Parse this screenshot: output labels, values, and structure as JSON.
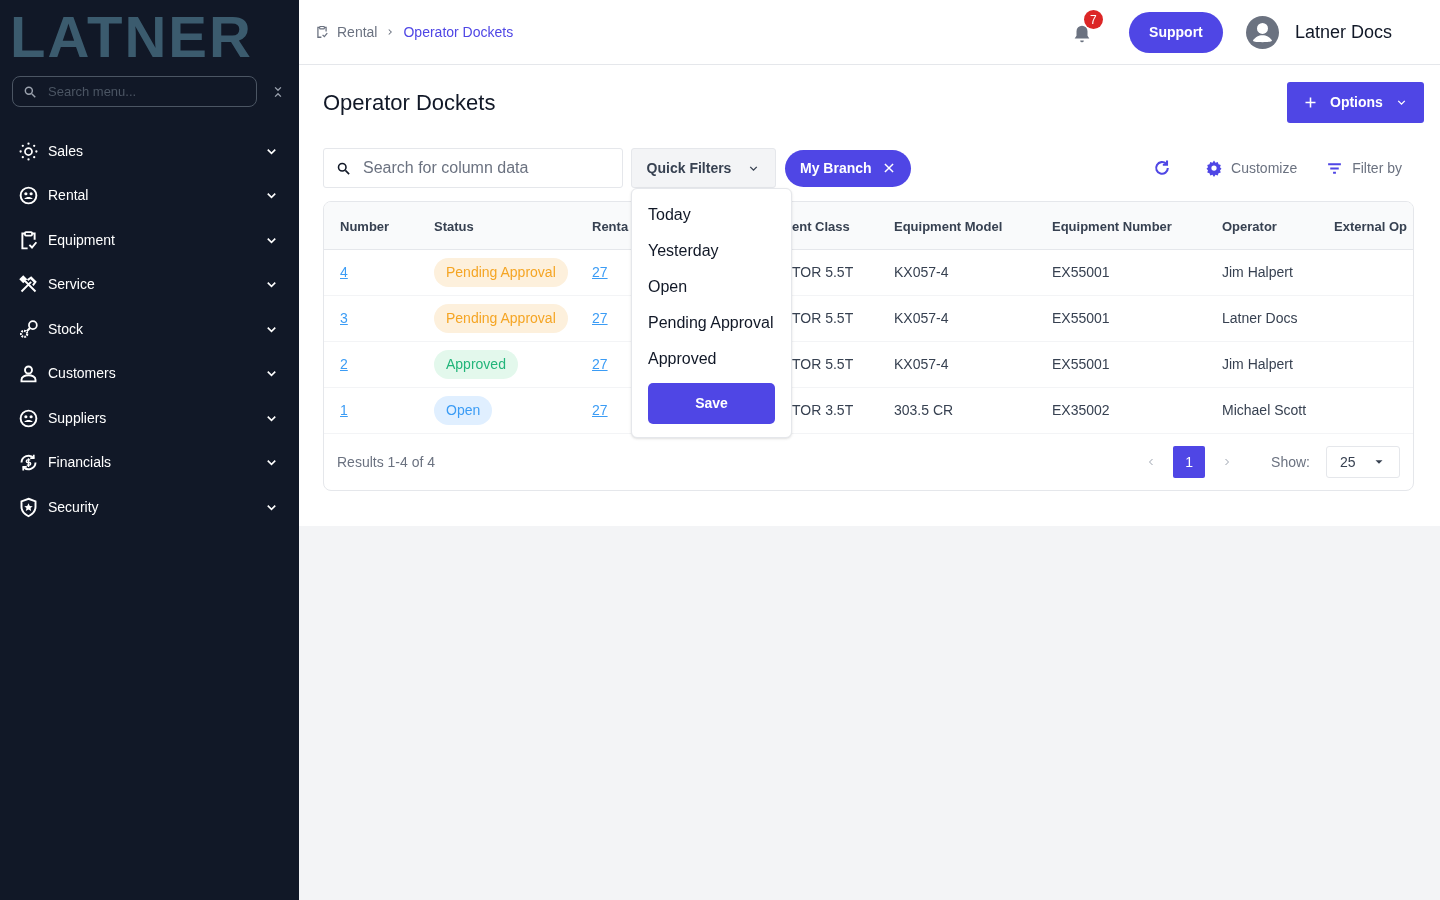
{
  "sidebar": {
    "logo": "LATNER",
    "search": {
      "placeholder": "Search menu..."
    },
    "items": [
      {
        "label": "Sales"
      },
      {
        "label": "Rental"
      },
      {
        "label": "Equipment"
      },
      {
        "label": "Service"
      },
      {
        "label": "Stock"
      },
      {
        "label": "Customers"
      },
      {
        "label": "Suppliers"
      },
      {
        "label": "Financials"
      },
      {
        "label": "Security"
      }
    ]
  },
  "header": {
    "breadcrumb": [
      "Rental",
      "Operator Dockets"
    ],
    "notifications": "7",
    "support": "Support",
    "user": "Latner Docs"
  },
  "page": {
    "title": "Operator Dockets",
    "options": "Options"
  },
  "toolbar": {
    "search": {
      "placeholder": "Search for column data"
    },
    "quick_filters": "Quick Filters",
    "chip": "My Branch",
    "customize": "Customize",
    "filter_by": "Filter by"
  },
  "quick_filter_menu": {
    "items": [
      "Today",
      "Yesterday",
      "Open",
      "Pending Approval",
      "Approved"
    ],
    "save": "Save"
  },
  "table": {
    "columns": [
      "Number",
      "Status",
      "Renta",
      "ent Class",
      "Equipment Model",
      "Equipment Number",
      "Operator",
      "External Op"
    ],
    "rows": [
      {
        "number": "4",
        "status": "Pending Approval",
        "kind": "pending",
        "rental": "27",
        "class": "TOR 5.5T",
        "model": "KX057-4",
        "equipment": "EX55001",
        "operator": "Jim Halpert"
      },
      {
        "number": "3",
        "status": "Pending Approval",
        "kind": "pending",
        "rental": "27",
        "class": "TOR 5.5T",
        "model": "KX057-4",
        "equipment": "EX55001",
        "operator": "Latner Docs"
      },
      {
        "number": "2",
        "status": "Approved",
        "kind": "approved",
        "rental": "27",
        "class": "TOR 5.5T",
        "model": "KX057-4",
        "equipment": "EX55001",
        "operator": "Jim Halpert"
      },
      {
        "number": "1",
        "status": "Open",
        "kind": "open",
        "rental": "27",
        "class": "TOR 3.5T",
        "model": "303.5 CR",
        "equipment": "EX35002",
        "operator": "Michael Scott"
      }
    ]
  },
  "footer": {
    "results": "Results 1-4 of 4",
    "pages": [
      {
        "label": "1",
        "selected": true
      }
    ],
    "show_label": "Show:",
    "page_size": "25"
  }
}
